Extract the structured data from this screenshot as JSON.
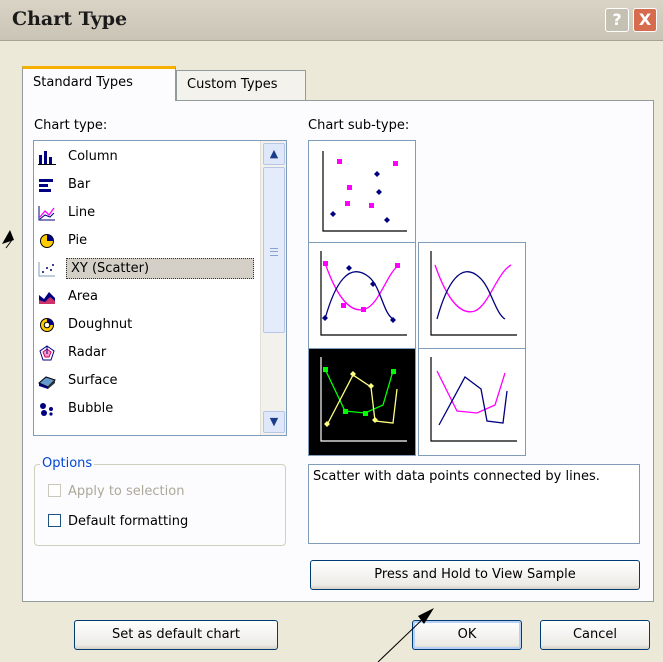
{
  "title": "Chart Type",
  "titlebar": {
    "help_glyph": "?",
    "close_glyph": "X"
  },
  "tabs": [
    {
      "label": "Standard Types",
      "active": true
    },
    {
      "label": "Custom Types",
      "active": false
    }
  ],
  "chart_type": {
    "label": "Chart type:",
    "items": [
      {
        "label": "Column",
        "icon": "column-chart-icon"
      },
      {
        "label": "Bar",
        "icon": "bar-chart-icon"
      },
      {
        "label": "Line",
        "icon": "line-chart-icon"
      },
      {
        "label": "Pie",
        "icon": "pie-chart-icon"
      },
      {
        "label": "XY (Scatter)",
        "icon": "scatter-chart-icon",
        "selected": true
      },
      {
        "label": "Area",
        "icon": "area-chart-icon"
      },
      {
        "label": "Doughnut",
        "icon": "doughnut-chart-icon"
      },
      {
        "label": "Radar",
        "icon": "radar-chart-icon"
      },
      {
        "label": "Surface",
        "icon": "surface-chart-icon"
      },
      {
        "label": "Bubble",
        "icon": "bubble-chart-icon"
      }
    ]
  },
  "sub_type": {
    "label": "Chart sub-type:",
    "selected_index": 3,
    "description": "Scatter with data points connected by lines."
  },
  "options": {
    "legend": "Options",
    "apply_to_selection": "Apply to selection",
    "default_formatting": "Default formatting"
  },
  "buttons": {
    "view_sample": "Press and Hold to View Sample",
    "set_default": "Set as default chart",
    "ok": "OK",
    "cancel": "Cancel"
  },
  "colors": {
    "magenta": "#ff00ff",
    "navy": "#000080",
    "green": "#00ff00",
    "yellow": "#ffff80",
    "accent_tab": "#f5b000"
  }
}
